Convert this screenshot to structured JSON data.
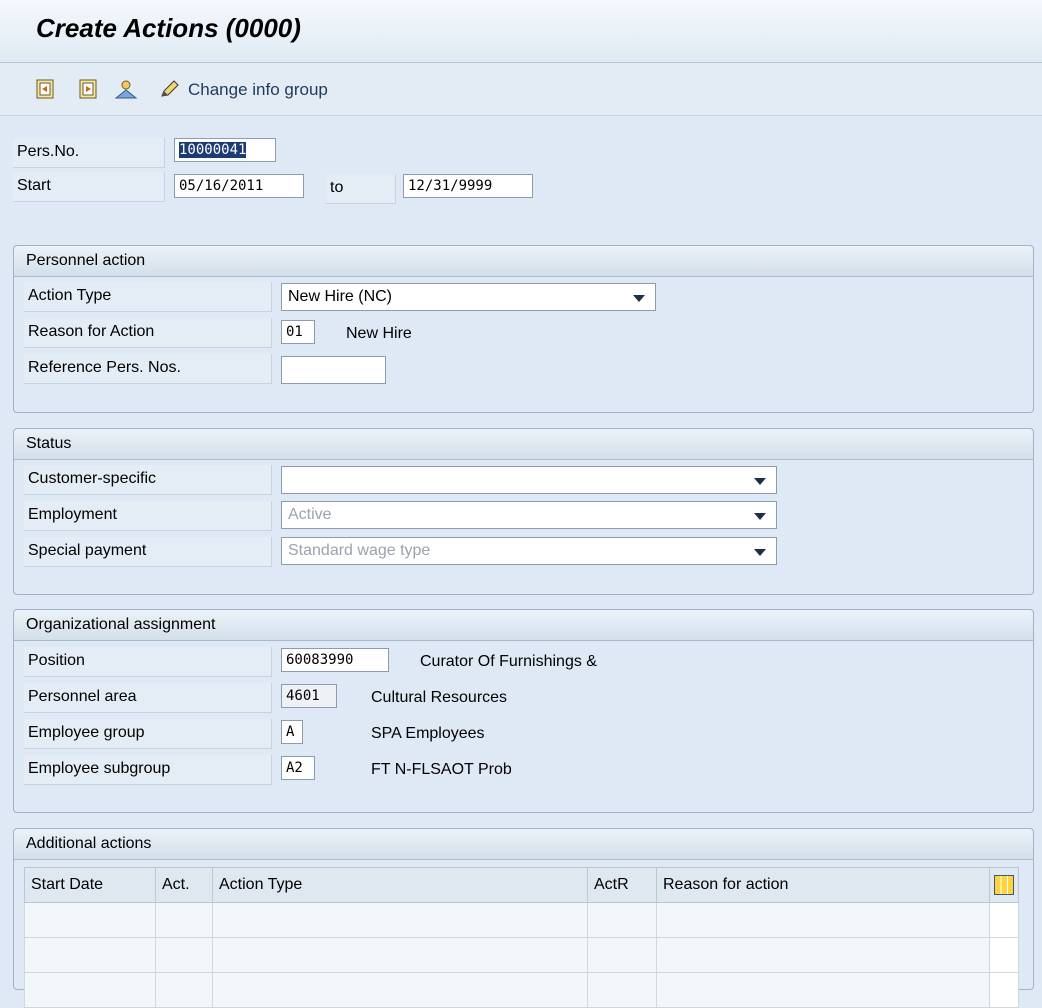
{
  "window": {
    "title": "Create Actions (0000)"
  },
  "toolbar": {
    "icons": [
      "previous-record-icon",
      "next-record-icon",
      "person-icon",
      "pencil-icon"
    ],
    "change_info_group": "Change info group"
  },
  "header": {
    "pers_no_label": "Pers.No.",
    "pers_no_value": "10000041",
    "start_label": "Start",
    "start_value": "05/16/2011",
    "to_label": "to",
    "end_value": "12/31/9999"
  },
  "personnel_action": {
    "title": "Personnel action",
    "action_type_label": "Action Type",
    "action_type_value": "New Hire (NC)",
    "reason_label": "Reason for Action",
    "reason_code": "01",
    "reason_text": "New Hire",
    "ref_pers_label": "Reference Pers. Nos.",
    "ref_pers_value": ""
  },
  "status": {
    "title": "Status",
    "customer_specific_label": "Customer-specific",
    "customer_specific_value": "",
    "employment_label": "Employment",
    "employment_value": "Active",
    "special_payment_label": "Special payment",
    "special_payment_value": "Standard wage type"
  },
  "org_assignment": {
    "title": "Organizational assignment",
    "position_label": "Position",
    "position_code": "60083990",
    "position_text": "Curator Of Furnishings &",
    "personnel_area_label": "Personnel area",
    "personnel_area_code": "4601",
    "personnel_area_text": "Cultural Resources",
    "employee_group_label": "Employee group",
    "employee_group_code": "A",
    "employee_group_text": "SPA Employees",
    "employee_subgroup_label": "Employee subgroup",
    "employee_subgroup_code": "A2",
    "employee_subgroup_text": "FT N-FLSAOT Prob"
  },
  "additional_actions": {
    "title": "Additional actions",
    "columns": [
      "Start Date",
      "Act.",
      "Action Type",
      "ActR",
      "Reason for action"
    ]
  },
  "colors": {
    "background": "#dfe9f5",
    "selection": "#1c3b75",
    "group_border": "#9fb2c6"
  }
}
